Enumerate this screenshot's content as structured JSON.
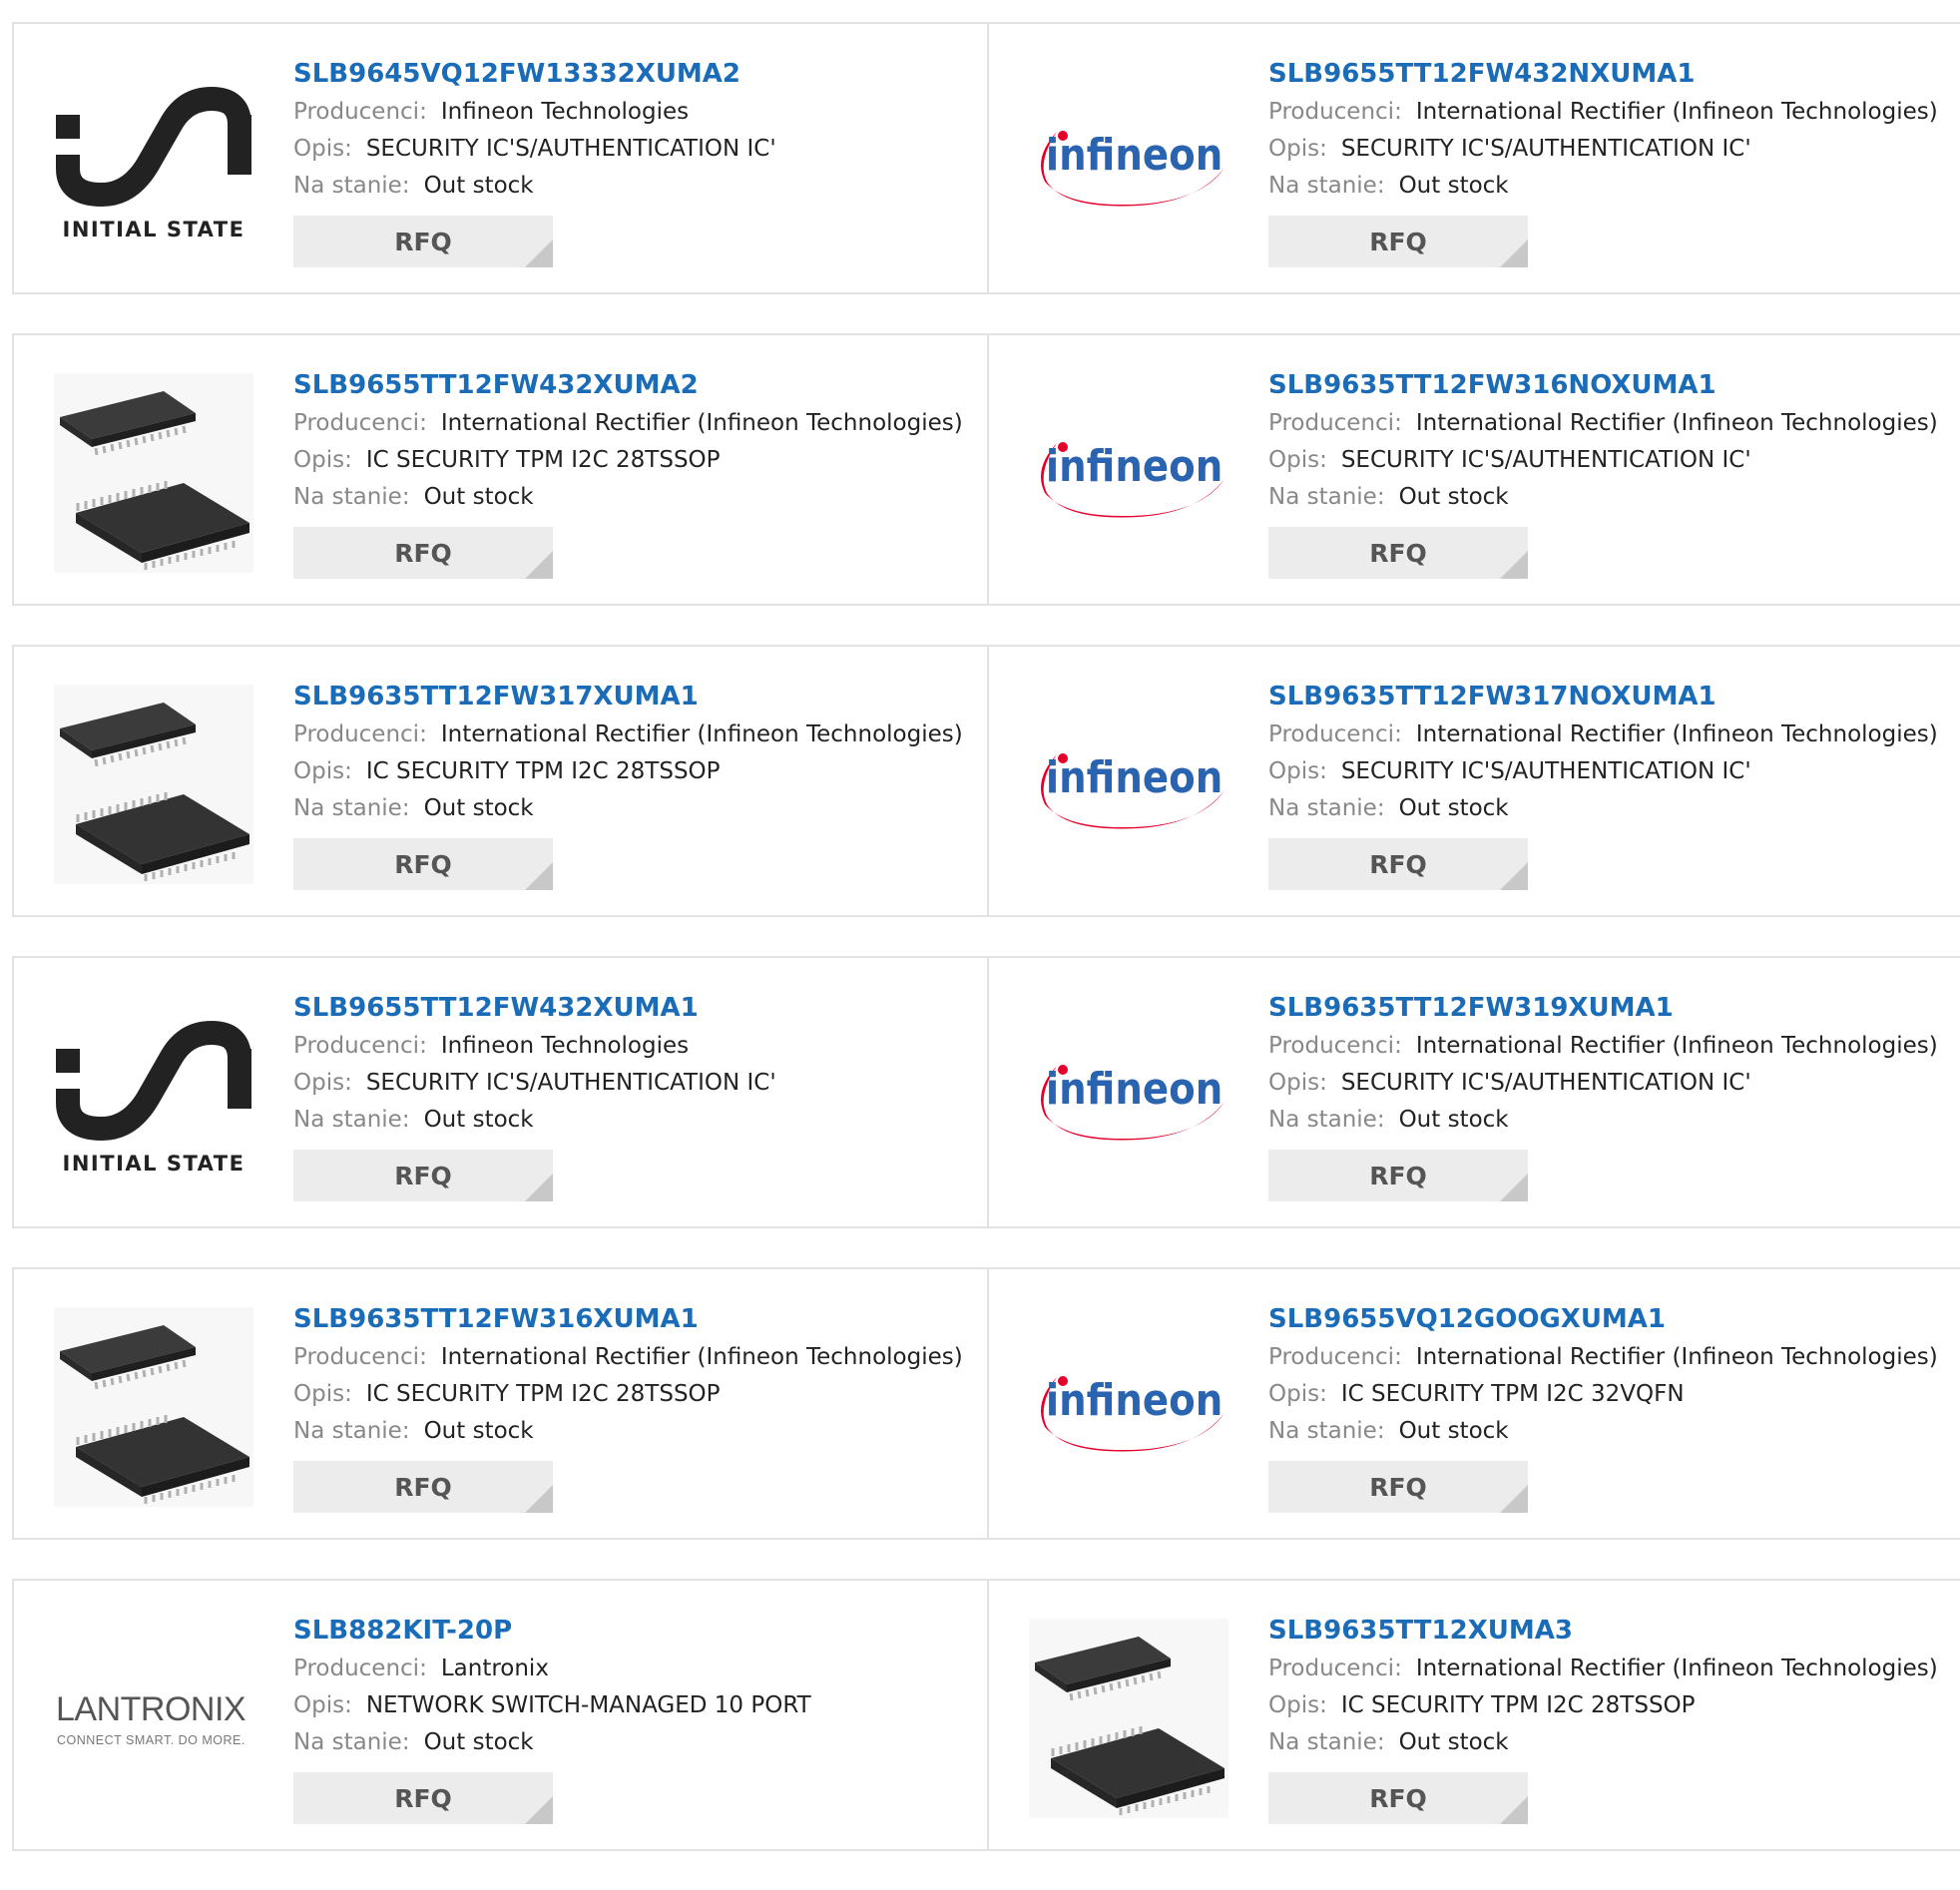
{
  "labels": {
    "manufacturer": "Producenci:",
    "description": "Opis:",
    "stock": "Na stanie:",
    "rfq": "RFQ"
  },
  "logos": {
    "initial_state_text": "INITIAL STATE",
    "infineon_text": "infineon",
    "lantronix_text": "LANTRONIX",
    "lantronix_tagline": "CONNECT SMART. DO MORE."
  },
  "products": [
    {
      "part": "SLB9645VQ12FW13332XUMA2",
      "manufacturer": "Infineon Technologies",
      "description": "SECURITY IC'S/AUTHENTICATION IC'",
      "stock": "Out stock",
      "image": "initial-state-logo"
    },
    {
      "part": "SLB9655TT12FW432NXUMA1",
      "manufacturer": "International Rectifier (Infineon Technologies)",
      "description": "SECURITY IC'S/AUTHENTICATION IC'",
      "stock": "Out stock",
      "image": "infineon-logo"
    },
    {
      "part": "SLB9655TT12FW432XUMA2",
      "manufacturer": "International Rectifier (Infineon Technologies)",
      "description": "IC SECURITY TPM I2C 28TSSOP",
      "stock": "Out stock",
      "image": "chip-image"
    },
    {
      "part": "SLB9635TT12FW316NOXUMA1",
      "manufacturer": "International Rectifier (Infineon Technologies)",
      "description": "SECURITY IC'S/AUTHENTICATION IC'",
      "stock": "Out stock",
      "image": "infineon-logo"
    },
    {
      "part": "SLB9635TT12FW317XUMA1",
      "manufacturer": "International Rectifier (Infineon Technologies)",
      "description": "IC SECURITY TPM I2C 28TSSOP",
      "stock": "Out stock",
      "image": "chip-image"
    },
    {
      "part": "SLB9635TT12FW317NOXUMA1",
      "manufacturer": "International Rectifier (Infineon Technologies)",
      "description": "SECURITY IC'S/AUTHENTICATION IC'",
      "stock": "Out stock",
      "image": "infineon-logo"
    },
    {
      "part": "SLB9655TT12FW432XUMA1",
      "manufacturer": "Infineon Technologies",
      "description": "SECURITY IC'S/AUTHENTICATION IC'",
      "stock": "Out stock",
      "image": "initial-state-logo"
    },
    {
      "part": "SLB9635TT12FW319XUMA1",
      "manufacturer": "International Rectifier (Infineon Technologies)",
      "description": "SECURITY IC'S/AUTHENTICATION IC'",
      "stock": "Out stock",
      "image": "infineon-logo"
    },
    {
      "part": "SLB9635TT12FW316XUMA1",
      "manufacturer": "International Rectifier (Infineon Technologies)",
      "description": "IC SECURITY TPM I2C 28TSSOP",
      "stock": "Out stock",
      "image": "chip-image"
    },
    {
      "part": "SLB9655VQ12GOOGXUMA1",
      "manufacturer": "International Rectifier (Infineon Technologies)",
      "description": "IC SECURITY TPM I2C 32VQFN",
      "stock": "Out stock",
      "image": "infineon-logo"
    },
    {
      "part": "SLB882KIT-20P",
      "manufacturer": "Lantronix",
      "description": "NETWORK SWITCH-MANAGED 10 PORT",
      "stock": "Out stock",
      "image": "lantronix-logo"
    },
    {
      "part": "SLB9635TT12XUMA3",
      "manufacturer": "International Rectifier (Infineon Technologies)",
      "description": "IC SECURITY TPM I2C 28TSSOP",
      "stock": "Out stock",
      "image": "chip-image"
    }
  ],
  "colors": {
    "link": "#1a6cb8",
    "label": "#888888",
    "infineon_blue": "#2a64b0",
    "infineon_red": "#e4002b"
  }
}
